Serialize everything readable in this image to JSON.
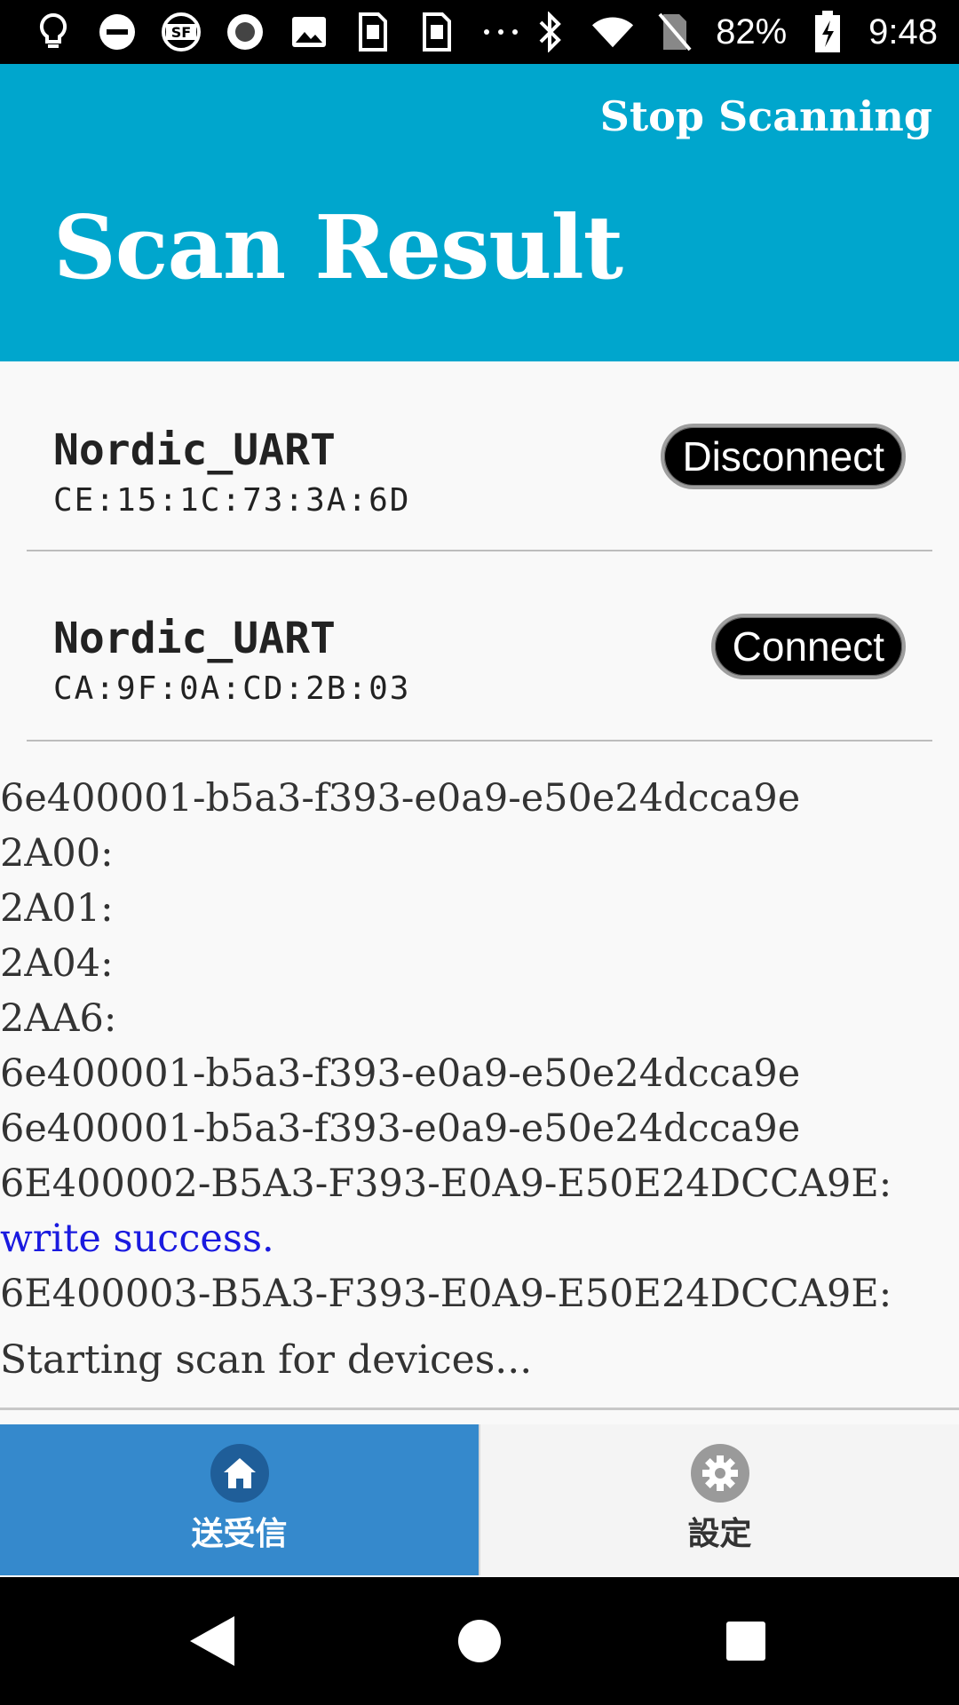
{
  "status_bar": {
    "battery_percent": "82%",
    "time": "9:48",
    "icons_left": [
      "lightbulb-icon",
      "do-not-disturb-icon",
      "sf-icon",
      "record-icon",
      "image-icon",
      "sim-card-icon",
      "sim-card-icon",
      "more-dots-icon"
    ],
    "icons_right": [
      "bluetooth-icon",
      "wifi-icon",
      "no-sim-icon",
      "battery-charging-icon"
    ]
  },
  "header": {
    "action_label": "Stop Scanning",
    "title": "Scan Result",
    "background_color": "#00a6cd"
  },
  "devices": [
    {
      "name": "Nordic_UART",
      "address": "CE:15:1C:73:3A:6D",
      "button_label": "Disconnect"
    },
    {
      "name": "Nordic_UART",
      "address": "CA:9F:0A:CD:2B:03",
      "button_label": "Connect"
    }
  ],
  "log": {
    "lines": [
      "6e400001-b5a3-f393-e0a9-e50e24dcca9e",
      "2A00:",
      "2A01:",
      "2A04:",
      "2AA6:",
      "6e400001-b5a3-f393-e0a9-e50e24dcca9e",
      "6e400001-b5a3-f393-e0a9-e50e24dcca9e",
      "6E400002-B5A3-F393-E0A9-E50E24DCCA9E:",
      "write success.",
      "6E400003-B5A3-F393-E0A9-E50E24DCCA9E:"
    ],
    "status": "Starting scan for devices..."
  },
  "tabs": [
    {
      "label": "送受信",
      "icon": "home-icon",
      "active": true
    },
    {
      "label": "設定",
      "icon": "gear-icon",
      "active": false
    }
  ],
  "nav": [
    "back-icon",
    "home-circle-icon",
    "recents-icon"
  ]
}
